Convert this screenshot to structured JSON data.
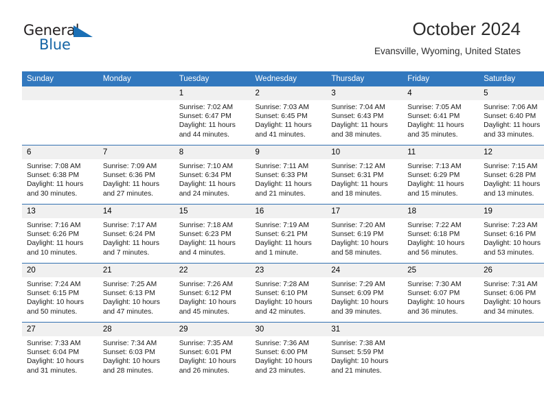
{
  "brand": {
    "name_part1": "General",
    "name_part2": "Blue",
    "logo_icon": "triangle-logo-icon"
  },
  "header": {
    "month_title": "October 2024",
    "location": "Evansville, Wyoming, United States"
  },
  "colors": {
    "header_blue": "#3278be",
    "row_divider_blue": "#2f6fb0",
    "daynum_background": "#f0f0f0",
    "brand_blue": "#1464a5"
  },
  "weekday_headers": [
    "Sunday",
    "Monday",
    "Tuesday",
    "Wednesday",
    "Thursday",
    "Friday",
    "Saturday"
  ],
  "weeks": [
    [
      {
        "day": "",
        "blank": true,
        "sunrise": "",
        "sunset": "",
        "daylight_line1": "",
        "daylight_line2": ""
      },
      {
        "day": "",
        "blank": true,
        "sunrise": "",
        "sunset": "",
        "daylight_line1": "",
        "daylight_line2": ""
      },
      {
        "day": "1",
        "blank": false,
        "sunrise": "Sunrise: 7:02 AM",
        "sunset": "Sunset: 6:47 PM",
        "daylight_line1": "Daylight: 11 hours",
        "daylight_line2": "and 44 minutes."
      },
      {
        "day": "2",
        "blank": false,
        "sunrise": "Sunrise: 7:03 AM",
        "sunset": "Sunset: 6:45 PM",
        "daylight_line1": "Daylight: 11 hours",
        "daylight_line2": "and 41 minutes."
      },
      {
        "day": "3",
        "blank": false,
        "sunrise": "Sunrise: 7:04 AM",
        "sunset": "Sunset: 6:43 PM",
        "daylight_line1": "Daylight: 11 hours",
        "daylight_line2": "and 38 minutes."
      },
      {
        "day": "4",
        "blank": false,
        "sunrise": "Sunrise: 7:05 AM",
        "sunset": "Sunset: 6:41 PM",
        "daylight_line1": "Daylight: 11 hours",
        "daylight_line2": "and 35 minutes."
      },
      {
        "day": "5",
        "blank": false,
        "sunrise": "Sunrise: 7:06 AM",
        "sunset": "Sunset: 6:40 PM",
        "daylight_line1": "Daylight: 11 hours",
        "daylight_line2": "and 33 minutes."
      }
    ],
    [
      {
        "day": "6",
        "blank": false,
        "sunrise": "Sunrise: 7:08 AM",
        "sunset": "Sunset: 6:38 PM",
        "daylight_line1": "Daylight: 11 hours",
        "daylight_line2": "and 30 minutes."
      },
      {
        "day": "7",
        "blank": false,
        "sunrise": "Sunrise: 7:09 AM",
        "sunset": "Sunset: 6:36 PM",
        "daylight_line1": "Daylight: 11 hours",
        "daylight_line2": "and 27 minutes."
      },
      {
        "day": "8",
        "blank": false,
        "sunrise": "Sunrise: 7:10 AM",
        "sunset": "Sunset: 6:34 PM",
        "daylight_line1": "Daylight: 11 hours",
        "daylight_line2": "and 24 minutes."
      },
      {
        "day": "9",
        "blank": false,
        "sunrise": "Sunrise: 7:11 AM",
        "sunset": "Sunset: 6:33 PM",
        "daylight_line1": "Daylight: 11 hours",
        "daylight_line2": "and 21 minutes."
      },
      {
        "day": "10",
        "blank": false,
        "sunrise": "Sunrise: 7:12 AM",
        "sunset": "Sunset: 6:31 PM",
        "daylight_line1": "Daylight: 11 hours",
        "daylight_line2": "and 18 minutes."
      },
      {
        "day": "11",
        "blank": false,
        "sunrise": "Sunrise: 7:13 AM",
        "sunset": "Sunset: 6:29 PM",
        "daylight_line1": "Daylight: 11 hours",
        "daylight_line2": "and 15 minutes."
      },
      {
        "day": "12",
        "blank": false,
        "sunrise": "Sunrise: 7:15 AM",
        "sunset": "Sunset: 6:28 PM",
        "daylight_line1": "Daylight: 11 hours",
        "daylight_line2": "and 13 minutes."
      }
    ],
    [
      {
        "day": "13",
        "blank": false,
        "sunrise": "Sunrise: 7:16 AM",
        "sunset": "Sunset: 6:26 PM",
        "daylight_line1": "Daylight: 11 hours",
        "daylight_line2": "and 10 minutes."
      },
      {
        "day": "14",
        "blank": false,
        "sunrise": "Sunrise: 7:17 AM",
        "sunset": "Sunset: 6:24 PM",
        "daylight_line1": "Daylight: 11 hours",
        "daylight_line2": "and 7 minutes."
      },
      {
        "day": "15",
        "blank": false,
        "sunrise": "Sunrise: 7:18 AM",
        "sunset": "Sunset: 6:23 PM",
        "daylight_line1": "Daylight: 11 hours",
        "daylight_line2": "and 4 minutes."
      },
      {
        "day": "16",
        "blank": false,
        "sunrise": "Sunrise: 7:19 AM",
        "sunset": "Sunset: 6:21 PM",
        "daylight_line1": "Daylight: 11 hours",
        "daylight_line2": "and 1 minute."
      },
      {
        "day": "17",
        "blank": false,
        "sunrise": "Sunrise: 7:20 AM",
        "sunset": "Sunset: 6:19 PM",
        "daylight_line1": "Daylight: 10 hours",
        "daylight_line2": "and 58 minutes."
      },
      {
        "day": "18",
        "blank": false,
        "sunrise": "Sunrise: 7:22 AM",
        "sunset": "Sunset: 6:18 PM",
        "daylight_line1": "Daylight: 10 hours",
        "daylight_line2": "and 56 minutes."
      },
      {
        "day": "19",
        "blank": false,
        "sunrise": "Sunrise: 7:23 AM",
        "sunset": "Sunset: 6:16 PM",
        "daylight_line1": "Daylight: 10 hours",
        "daylight_line2": "and 53 minutes."
      }
    ],
    [
      {
        "day": "20",
        "blank": false,
        "sunrise": "Sunrise: 7:24 AM",
        "sunset": "Sunset: 6:15 PM",
        "daylight_line1": "Daylight: 10 hours",
        "daylight_line2": "and 50 minutes."
      },
      {
        "day": "21",
        "blank": false,
        "sunrise": "Sunrise: 7:25 AM",
        "sunset": "Sunset: 6:13 PM",
        "daylight_line1": "Daylight: 10 hours",
        "daylight_line2": "and 47 minutes."
      },
      {
        "day": "22",
        "blank": false,
        "sunrise": "Sunrise: 7:26 AM",
        "sunset": "Sunset: 6:12 PM",
        "daylight_line1": "Daylight: 10 hours",
        "daylight_line2": "and 45 minutes."
      },
      {
        "day": "23",
        "blank": false,
        "sunrise": "Sunrise: 7:28 AM",
        "sunset": "Sunset: 6:10 PM",
        "daylight_line1": "Daylight: 10 hours",
        "daylight_line2": "and 42 minutes."
      },
      {
        "day": "24",
        "blank": false,
        "sunrise": "Sunrise: 7:29 AM",
        "sunset": "Sunset: 6:09 PM",
        "daylight_line1": "Daylight: 10 hours",
        "daylight_line2": "and 39 minutes."
      },
      {
        "day": "25",
        "blank": false,
        "sunrise": "Sunrise: 7:30 AM",
        "sunset": "Sunset: 6:07 PM",
        "daylight_line1": "Daylight: 10 hours",
        "daylight_line2": "and 36 minutes."
      },
      {
        "day": "26",
        "blank": false,
        "sunrise": "Sunrise: 7:31 AM",
        "sunset": "Sunset: 6:06 PM",
        "daylight_line1": "Daylight: 10 hours",
        "daylight_line2": "and 34 minutes."
      }
    ],
    [
      {
        "day": "27",
        "blank": false,
        "sunrise": "Sunrise: 7:33 AM",
        "sunset": "Sunset: 6:04 PM",
        "daylight_line1": "Daylight: 10 hours",
        "daylight_line2": "and 31 minutes."
      },
      {
        "day": "28",
        "blank": false,
        "sunrise": "Sunrise: 7:34 AM",
        "sunset": "Sunset: 6:03 PM",
        "daylight_line1": "Daylight: 10 hours",
        "daylight_line2": "and 28 minutes."
      },
      {
        "day": "29",
        "blank": false,
        "sunrise": "Sunrise: 7:35 AM",
        "sunset": "Sunset: 6:01 PM",
        "daylight_line1": "Daylight: 10 hours",
        "daylight_line2": "and 26 minutes."
      },
      {
        "day": "30",
        "blank": false,
        "sunrise": "Sunrise: 7:36 AM",
        "sunset": "Sunset: 6:00 PM",
        "daylight_line1": "Daylight: 10 hours",
        "daylight_line2": "and 23 minutes."
      },
      {
        "day": "31",
        "blank": false,
        "sunrise": "Sunrise: 7:38 AM",
        "sunset": "Sunset: 5:59 PM",
        "daylight_line1": "Daylight: 10 hours",
        "daylight_line2": "and 21 minutes."
      },
      {
        "day": "",
        "blank": true,
        "sunrise": "",
        "sunset": "",
        "daylight_line1": "",
        "daylight_line2": ""
      },
      {
        "day": "",
        "blank": true,
        "sunrise": "",
        "sunset": "",
        "daylight_line1": "",
        "daylight_line2": ""
      }
    ]
  ]
}
